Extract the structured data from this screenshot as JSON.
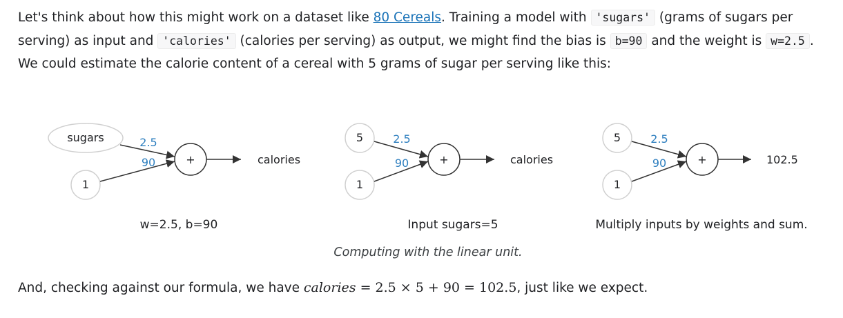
{
  "paragraph1": {
    "t1": "Let's think about how this might work on a dataset like ",
    "link": "80 Cereals",
    "t2": ". Training a model with ",
    "code1": "'sugars'",
    "t3": " (grams of sugars per serving) as input and ",
    "code2": "'calories'",
    "t4": " (calories per serving) as output, we might find the bias is ",
    "code3": "b=90",
    "t5": " and the weight is ",
    "code4": "w=2.5",
    "t6": ". We could estimate the calorie content of a cereal with 5 grams of sugar per serving like this:"
  },
  "figure": {
    "panels": [
      {
        "input_top": "sugars",
        "input_bottom": "1",
        "weight": "2.5",
        "bias": "90",
        "sum_symbol": "+",
        "output": "calories",
        "subcaption": "w=2.5, b=90"
      },
      {
        "input_top": "5",
        "input_bottom": "1",
        "weight": "2.5",
        "bias": "90",
        "sum_symbol": "+",
        "output": "calories",
        "subcaption": "Input sugars=5"
      },
      {
        "input_top": "5",
        "input_bottom": "1",
        "weight": "2.5",
        "bias": "90",
        "sum_symbol": "+",
        "output": "102.5",
        "subcaption": "Multiply inputs by weights and sum."
      }
    ],
    "caption": "Computing with the linear unit.",
    "colors": {
      "weight_label": "#2e7fbf",
      "node_stroke": "#d0d0d0",
      "sum_stroke": "#333333"
    }
  },
  "paragraph2": {
    "t1": "And, checking against our formula, we have ",
    "math_var": "calories",
    "math_rest": " = 2.5 × 5 + 90 = 102.5",
    "t2": ", just like we expect."
  }
}
